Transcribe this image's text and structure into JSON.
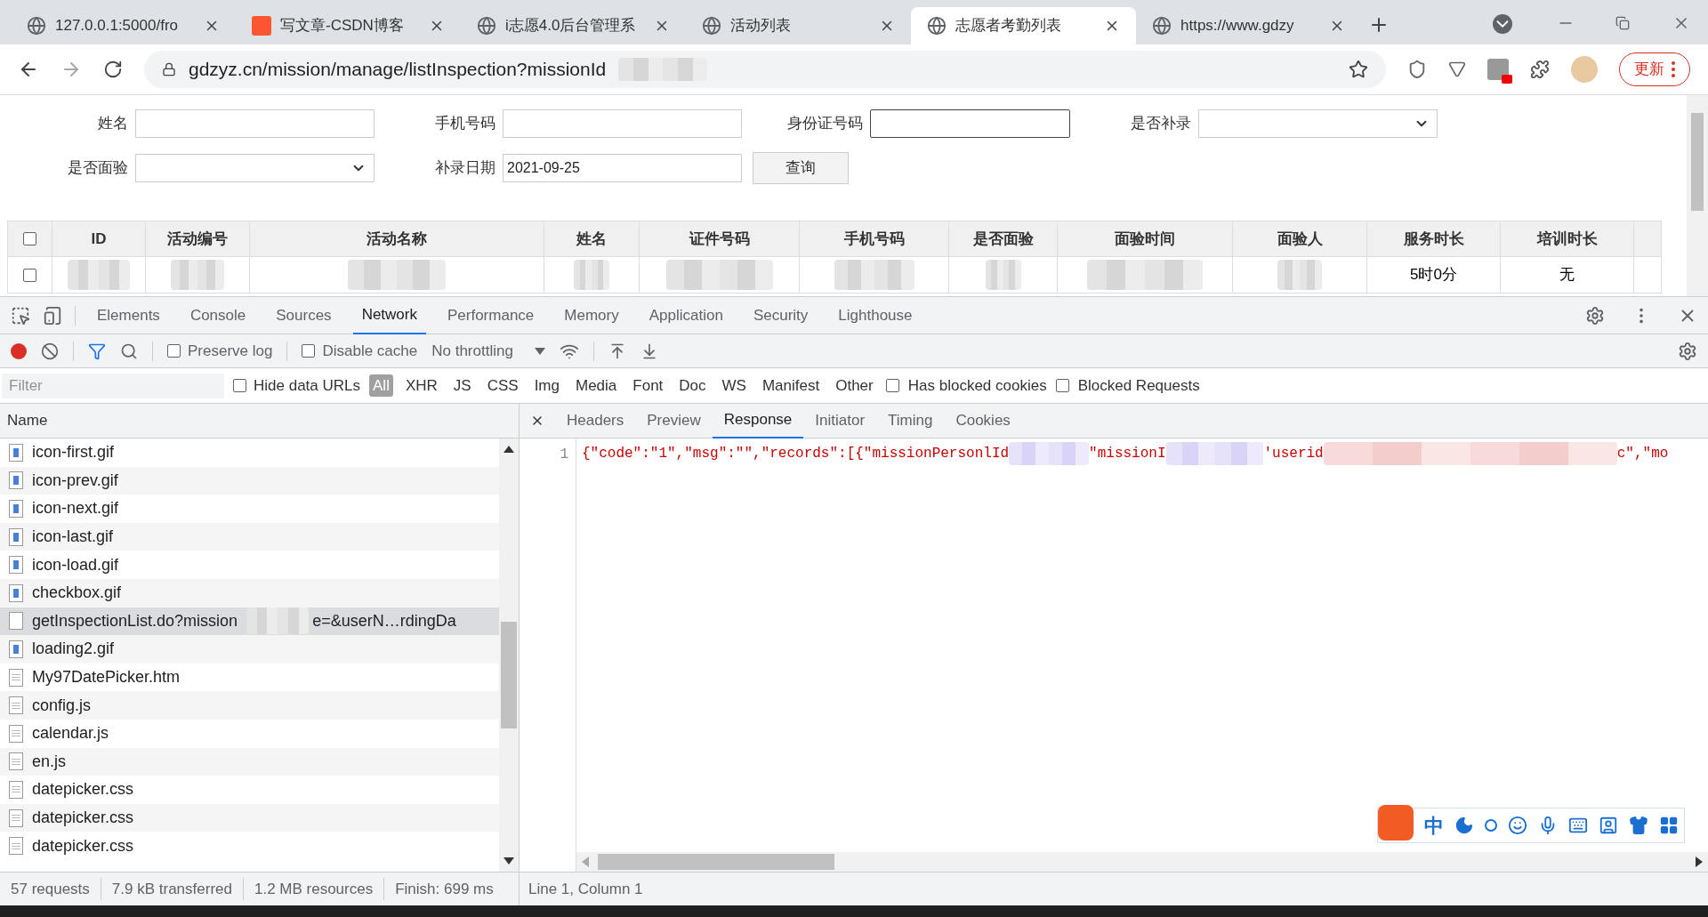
{
  "browser_tabs": [
    {
      "title": "127.0.0.1:5000/fro",
      "kind": "web",
      "selected": false
    },
    {
      "title": "写文章-CSDN博客",
      "kind": "brand",
      "selected": false
    },
    {
      "title": "i志愿4.0后台管理系",
      "kind": "web",
      "selected": false
    },
    {
      "title": "活动列表",
      "kind": "web",
      "selected": false
    },
    {
      "title": "志愿者考勤列表",
      "kind": "web",
      "selected": true
    },
    {
      "title": "https://www.gdzy",
      "kind": "web",
      "selected": false
    }
  ],
  "address_bar": {
    "url": "gdzyz.cn/mission/manage/listInspection?missionId",
    "update_button": "更新"
  },
  "search_form": {
    "fields": [
      {
        "label": "姓名",
        "kind": "text",
        "focused": false
      },
      {
        "label": "手机号码",
        "kind": "text",
        "focused": false
      },
      {
        "label": "身份证号码",
        "kind": "text",
        "focused": true
      },
      {
        "label": "是否补录",
        "kind": "select"
      },
      {
        "label": "是否面验",
        "kind": "select"
      },
      {
        "label": "补录日期",
        "kind": "text",
        "value": "2021-09-25",
        "focused": false
      }
    ],
    "query_button": "查询"
  },
  "table": {
    "all_checked": false,
    "columns": [
      "ID",
      "活动编号",
      "活动名称",
      "姓名",
      "证件号码",
      "手机号码",
      "是否面验",
      "面验时间",
      "面验人",
      "服务时长",
      "培训时长"
    ],
    "rows": [
      {
        "checked": false,
        "service_hours": "5时0分",
        "training_hours": "无"
      }
    ]
  },
  "devtools": {
    "tabs": [
      {
        "label": "Elements",
        "selected": false
      },
      {
        "label": "Console",
        "selected": false
      },
      {
        "label": "Sources",
        "selected": false
      },
      {
        "label": "Network",
        "selected": true
      },
      {
        "label": "Performance",
        "selected": false
      },
      {
        "label": "Memory",
        "selected": false
      },
      {
        "label": "Application",
        "selected": false
      },
      {
        "label": "Security",
        "selected": false
      },
      {
        "label": "Lighthouse",
        "selected": false
      }
    ],
    "preserve_log": {
      "label": "Preserve log",
      "checked": false
    },
    "disable_cache": {
      "label": "Disable cache",
      "checked": false
    },
    "throttling": "No throttling",
    "filter_placeholder": "Filter",
    "hide_data_urls": {
      "label": "Hide data URLs",
      "checked": false
    },
    "types": [
      {
        "label": "All",
        "selected": true
      },
      {
        "label": "XHR",
        "selected": false
      },
      {
        "label": "JS",
        "selected": false
      },
      {
        "label": "CSS",
        "selected": false
      },
      {
        "label": "Img",
        "selected": false
      },
      {
        "label": "Media",
        "selected": false
      },
      {
        "label": "Font",
        "selected": false
      },
      {
        "label": "Doc",
        "selected": false
      },
      {
        "label": "WS",
        "selected": false
      },
      {
        "label": "Manifest",
        "selected": false
      },
      {
        "label": "Other",
        "selected": false
      }
    ],
    "has_blocked_cookies": {
      "label": "Has blocked cookies",
      "checked": false
    },
    "blocked_requests": {
      "label": "Blocked Requests",
      "checked": false
    },
    "name_header": "Name",
    "requests": [
      {
        "name": "icon-first.gif",
        "kind": "image",
        "selected": false
      },
      {
        "name": "icon-prev.gif",
        "kind": "image",
        "selected": false
      },
      {
        "name": "icon-next.gif",
        "kind": "image",
        "selected": false
      },
      {
        "name": "icon-last.gif",
        "kind": "image",
        "selected": false
      },
      {
        "name": "icon-load.gif",
        "kind": "image",
        "selected": false
      },
      {
        "name": "checkbox.gif",
        "kind": "image",
        "selected": false
      },
      {
        "name": "getInspectionList.do?mission",
        "name_tail": "e=&userN…rdingDa",
        "kind": "xhr",
        "selected": true
      },
      {
        "name": "loading2.gif",
        "kind": "image",
        "selected": false
      },
      {
        "name": "My97DatePicker.htm",
        "kind": "document",
        "selected": false
      },
      {
        "name": "config.js",
        "kind": "document",
        "selected": false
      },
      {
        "name": "calendar.js",
        "kind": "document",
        "selected": false
      },
      {
        "name": "en.js",
        "kind": "document",
        "selected": false
      },
      {
        "name": "datepicker.css",
        "kind": "document",
        "selected": false
      },
      {
        "name": "datepicker.css",
        "kind": "document",
        "selected": false
      },
      {
        "name": "datepicker.css",
        "kind": "document",
        "selected": false
      }
    ],
    "detail_tabs": [
      {
        "label": "Headers",
        "selected": false
      },
      {
        "label": "Preview",
        "selected": false
      },
      {
        "label": "Response",
        "selected": true
      },
      {
        "label": "Initiator",
        "selected": false
      },
      {
        "label": "Timing",
        "selected": false
      },
      {
        "label": "Cookies",
        "selected": false
      }
    ],
    "response": {
      "line_number": "1",
      "segments": [
        "{\"code\":\"1\",\"msg\":\"\",\"records\":[{\"missionPersonlId",
        "\"missionI",
        "'userid",
        "c\",\"mo"
      ]
    },
    "summary": [
      "57 requests",
      "7.9 kB transferred",
      "1.2 MB resources",
      "Finish: 699 ms"
    ],
    "cursor_position": "Line 1, Column 1"
  },
  "ime_toolbar": {
    "mode": "中"
  }
}
